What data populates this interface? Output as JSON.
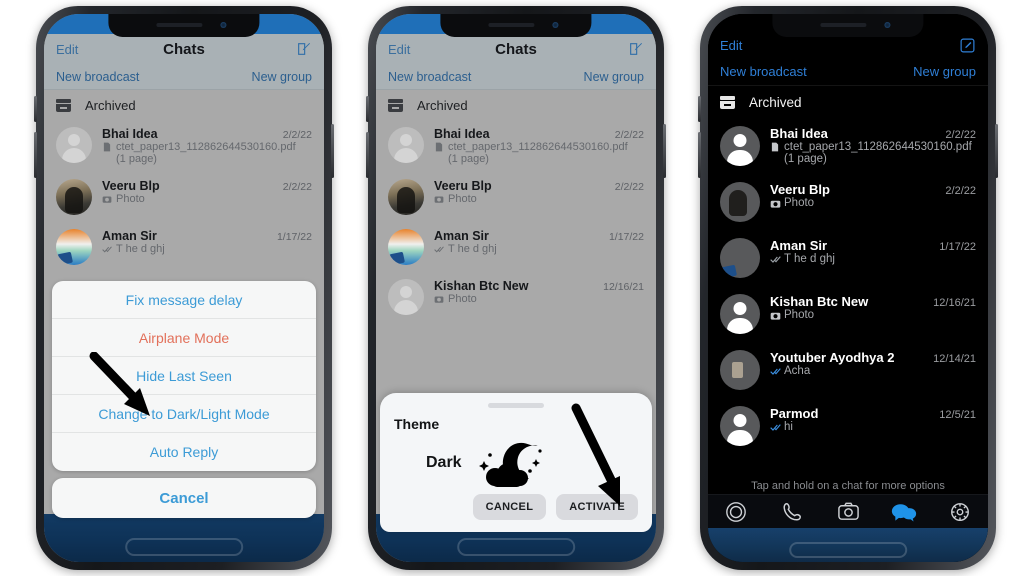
{
  "app": {
    "nav": {
      "edit": "Edit",
      "title": "Chats",
      "compose_icon": "compose-icon"
    },
    "subbar": {
      "broadcast": "New broadcast",
      "group": "New group"
    },
    "archived": "Archived",
    "hint": "Tap and hold on a chat for more options"
  },
  "colors": {
    "accent_blue": "#2f7fd6",
    "sheet_blue": "#3c9bd6",
    "danger_red": "#e2705a",
    "dark_bg": "#000000",
    "dimmed_bg": "#a9a9a9"
  },
  "chats": [
    {
      "name": "Bhai Idea",
      "time": "2/2/22",
      "icon": "document-icon",
      "preview": "ctet_paper13_112862644530160.pdf",
      "preview2": "(1 page)",
      "avatar": "placeholder"
    },
    {
      "name": "Veeru Blp",
      "time": "2/2/22",
      "icon": "camera-icon",
      "preview": "Photo",
      "preview2": "",
      "avatar": "photo-veeru"
    },
    {
      "name": "Aman Sir",
      "time": "1/17/22",
      "icon": "double-check-icon",
      "preview": "T he d ghj",
      "preview2": "",
      "avatar": "photo-aman"
    },
    {
      "name": "Kishan Btc New",
      "time": "12/16/21",
      "icon": "camera-icon",
      "preview": "Photo",
      "preview2": "",
      "avatar": "placeholder"
    },
    {
      "name": "Youtuber Ayodhya 2",
      "time": "12/14/21",
      "icon": "double-check-icon",
      "preview": "Acha",
      "preview2": "",
      "avatar": "photo-youtuber"
    },
    {
      "name": "Parmod",
      "time": "12/5/21",
      "icon": "double-check-icon",
      "preview": "hi",
      "preview2": "",
      "avatar": "placeholder"
    }
  ],
  "action_sheet": {
    "items": [
      {
        "label": "Fix message delay",
        "style": "normal"
      },
      {
        "label": "Airplane Mode",
        "style": "danger"
      },
      {
        "label": "Hide Last Seen",
        "style": "normal"
      },
      {
        "label": "Change to Dark/Light Mode",
        "style": "normal"
      },
      {
        "label": "Auto Reply",
        "style": "normal"
      }
    ],
    "cancel": "Cancel"
  },
  "theme_dialog": {
    "title": "Theme",
    "mode": "Dark",
    "icon": "moon-cloud-icon",
    "cancel": "CANCEL",
    "activate": "ACTIVATE"
  },
  "tabbar": [
    {
      "name": "status-tab",
      "icon": "status-rings-icon",
      "active": false
    },
    {
      "name": "calls-tab",
      "icon": "phone-icon",
      "active": false
    },
    {
      "name": "camera-tab",
      "icon": "camera-icon",
      "active": false
    },
    {
      "name": "chats-tab",
      "icon": "chat-bubbles-icon",
      "active": true
    },
    {
      "name": "settings-tab",
      "icon": "gear-icon",
      "active": false
    }
  ]
}
